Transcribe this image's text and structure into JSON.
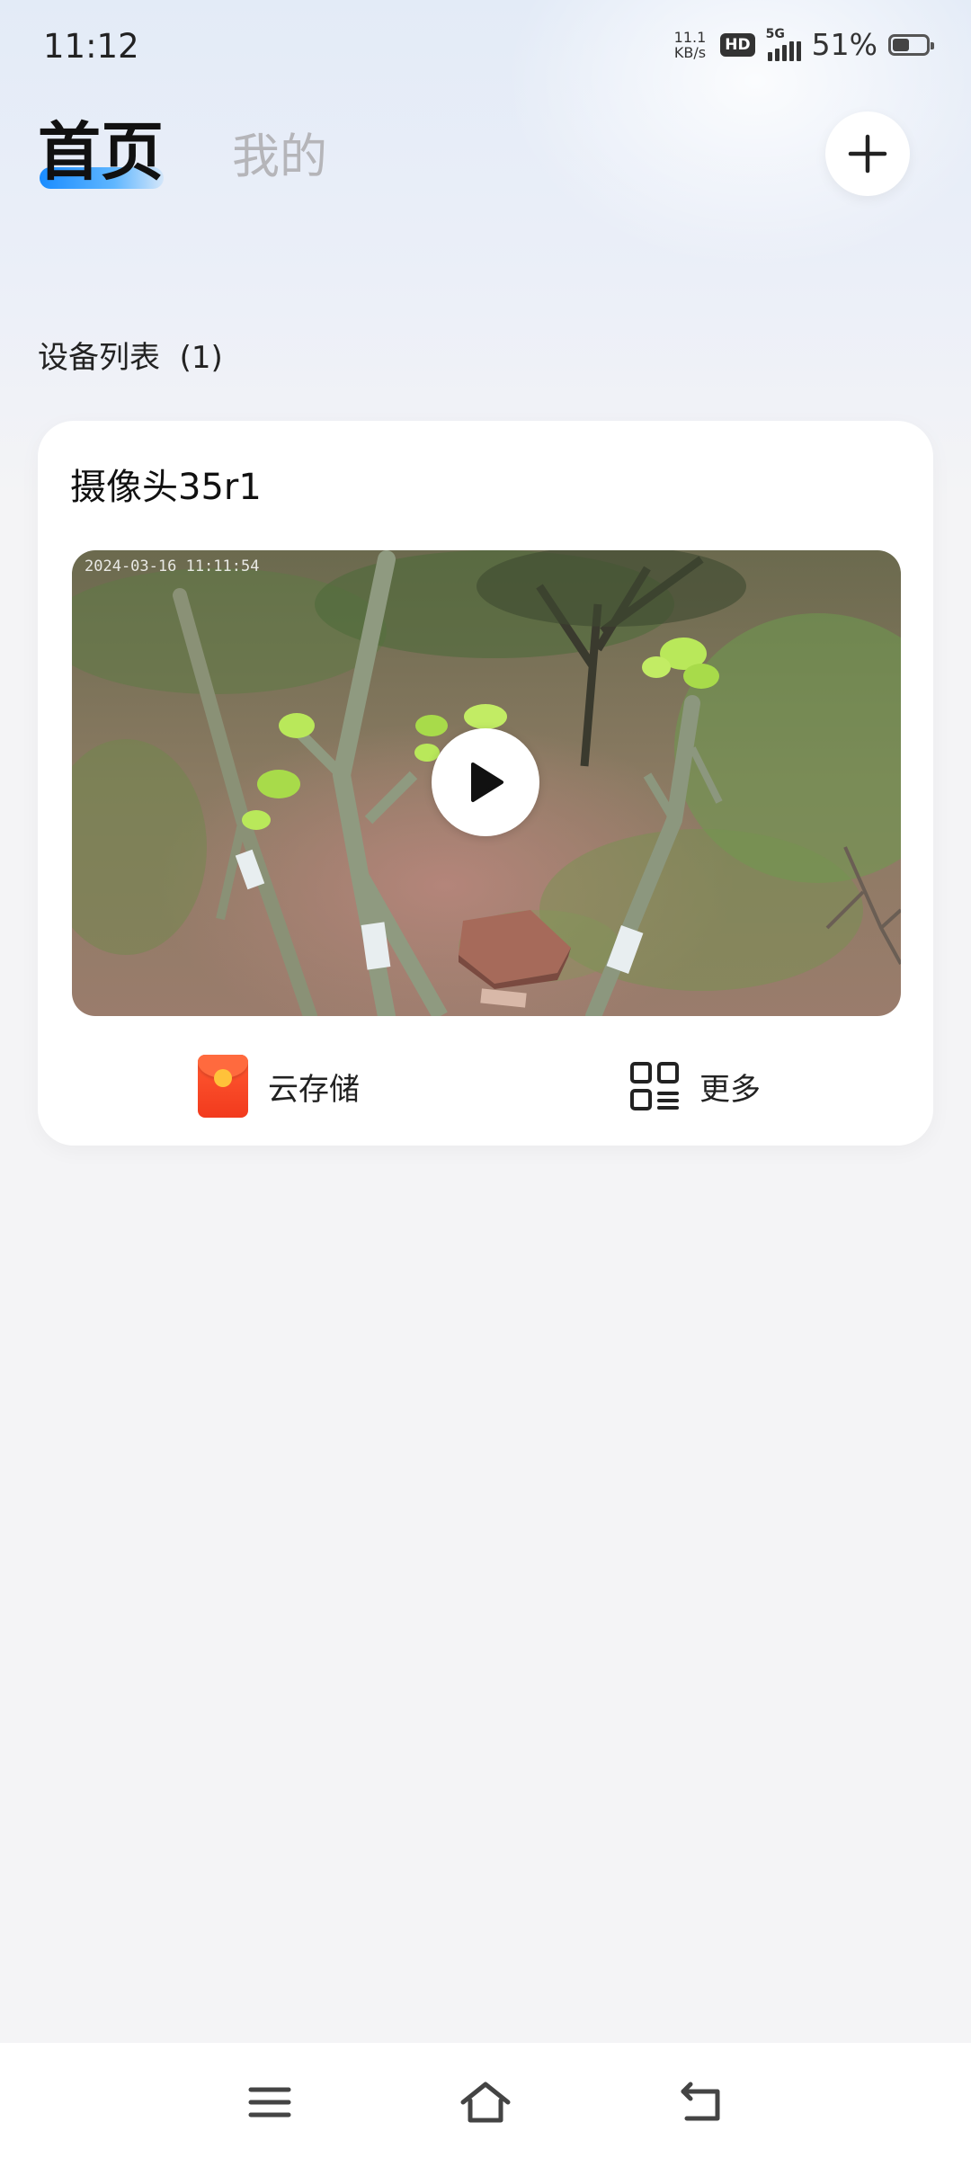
{
  "status_bar": {
    "time": "11:12",
    "net_speed_value": "11.1",
    "net_speed_unit": "KB/s",
    "hd_label": "HD",
    "network_type": "5G",
    "battery_percent": "51%",
    "battery_level": 0.51
  },
  "header": {
    "tabs": [
      {
        "label": "首页",
        "active": true
      },
      {
        "label": "我的",
        "active": false
      }
    ],
    "add_icon": "plus-icon",
    "accent_color": "#1a8cff"
  },
  "device_list": {
    "title": "设备列表",
    "count": "(1)",
    "devices": [
      {
        "name": "摄像头35r1",
        "timestamp": "2024-03-16 11:11:54",
        "play_icon": "play-icon",
        "actions": [
          {
            "label": "云存储",
            "icon": "red-envelope-icon"
          },
          {
            "label": "更多",
            "icon": "grid-more-icon"
          }
        ]
      }
    ]
  },
  "nav_bar": {
    "icons": [
      "menu-icon",
      "home-icon",
      "back-icon"
    ]
  }
}
